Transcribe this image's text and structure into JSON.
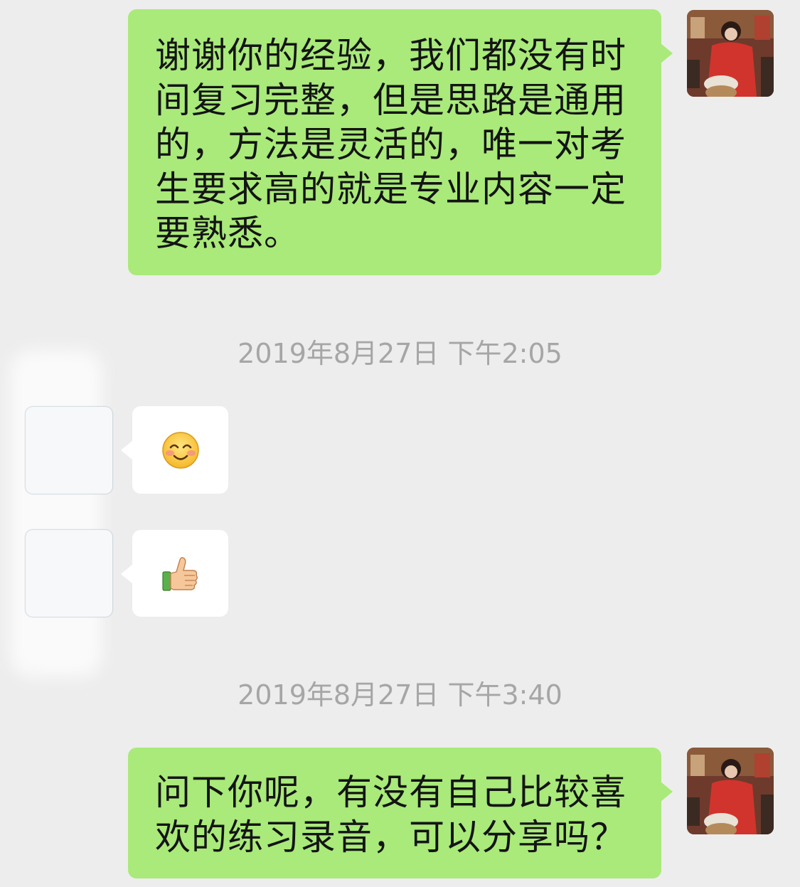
{
  "messages": [
    {
      "id": "m1",
      "direction": "outgoing",
      "text": "谢谢你的经验，我们都没有时间复习完整，但是思路是通用的，方法是灵活的，唯一对考生要求高的就是专业内容一定要熟悉。"
    },
    {
      "id": "ts1",
      "type": "timestamp",
      "text": "2019年8月27日 下午2:05"
    },
    {
      "id": "m2",
      "direction": "incoming",
      "emoji": "smiling-face-with-blush-icon"
    },
    {
      "id": "m3",
      "direction": "incoming",
      "emoji": "thumbs-up-icon"
    },
    {
      "id": "ts2",
      "type": "timestamp",
      "text": "2019年8月27日 下午3:40"
    },
    {
      "id": "m4",
      "direction": "outgoing",
      "text": "问下你呢，有没有自己比较喜欢的练习录音，可以分享吗？"
    }
  ],
  "colors": {
    "background": "#ededed",
    "outgoing_bubble": "#a9ea7a",
    "incoming_bubble": "#ffffff",
    "timestamp_text": "#a6a6a6",
    "message_text": "#141414"
  }
}
